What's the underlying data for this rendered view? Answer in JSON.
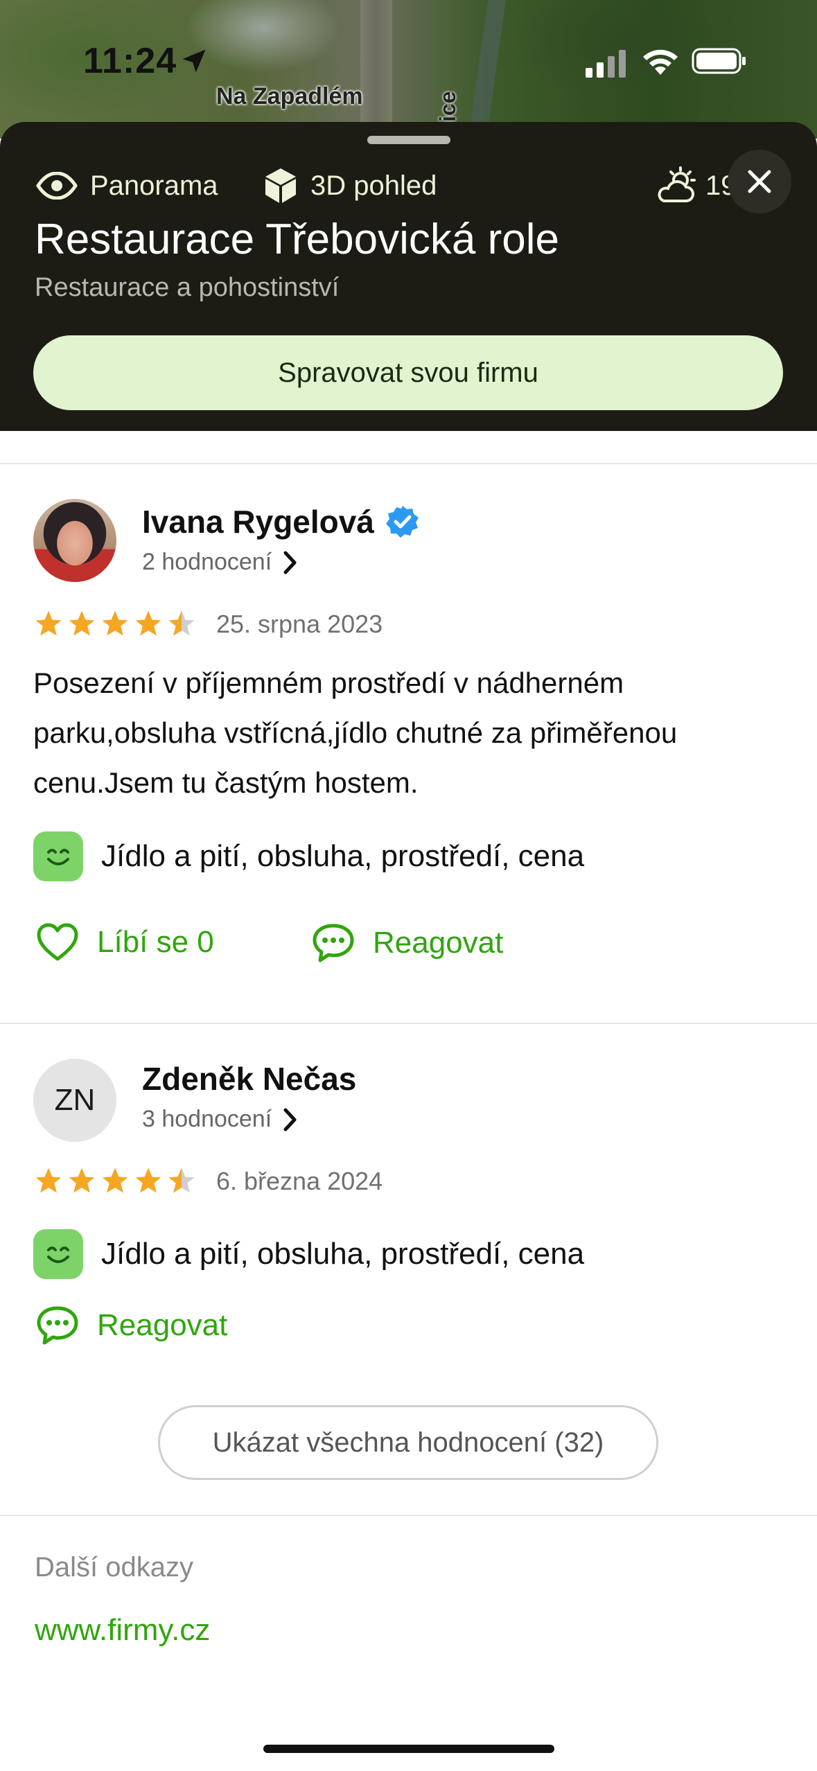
{
  "status_bar": {
    "time": "11:24"
  },
  "map": {
    "label_street": "Na Zapadlém",
    "label_vertical": "ice"
  },
  "header": {
    "panorama_label": "Panorama",
    "view3d_label": "3D pohled",
    "weather_temp": "19°",
    "title": "Restaurace Třebovická role",
    "subtitle": "Restaurace a pohostinství",
    "manage_button": "Spravovat svou firmu"
  },
  "reviews": [
    {
      "author": "Ivana Rygelová",
      "verified": true,
      "ratings_count": "2 hodnocení",
      "stars": 4.5,
      "date": "25. srpna 2023",
      "text": "Posezení v příjemném prostředí v nádherném parku,obsluha vstřícná,jídlo chutné za přiměřenou cenu.Jsem tu častým hostem.",
      "tags": "Jídlo a pití, obsluha, prostředí, cena",
      "like_label": "Líbí se 0",
      "reply_label": "Reagovat"
    },
    {
      "author": "Zdeněk Nečas",
      "initials": "ZN",
      "ratings_count": "3 hodnocení",
      "stars": 4.5,
      "date": "6. března 2024",
      "tags": "Jídlo a pití, obsluha, prostředí, cena",
      "reply_label": "Reagovat"
    }
  ],
  "show_all_button": "Ukázat všechna hodnocení (32)",
  "more_links": {
    "title": "Další odkazy",
    "link": "www.firmy.cz"
  },
  "colors": {
    "accent_green": "#2fa60d",
    "star": "#f5a623",
    "header_bg": "#1c1c15",
    "manage_bg": "#e2f3cf"
  }
}
